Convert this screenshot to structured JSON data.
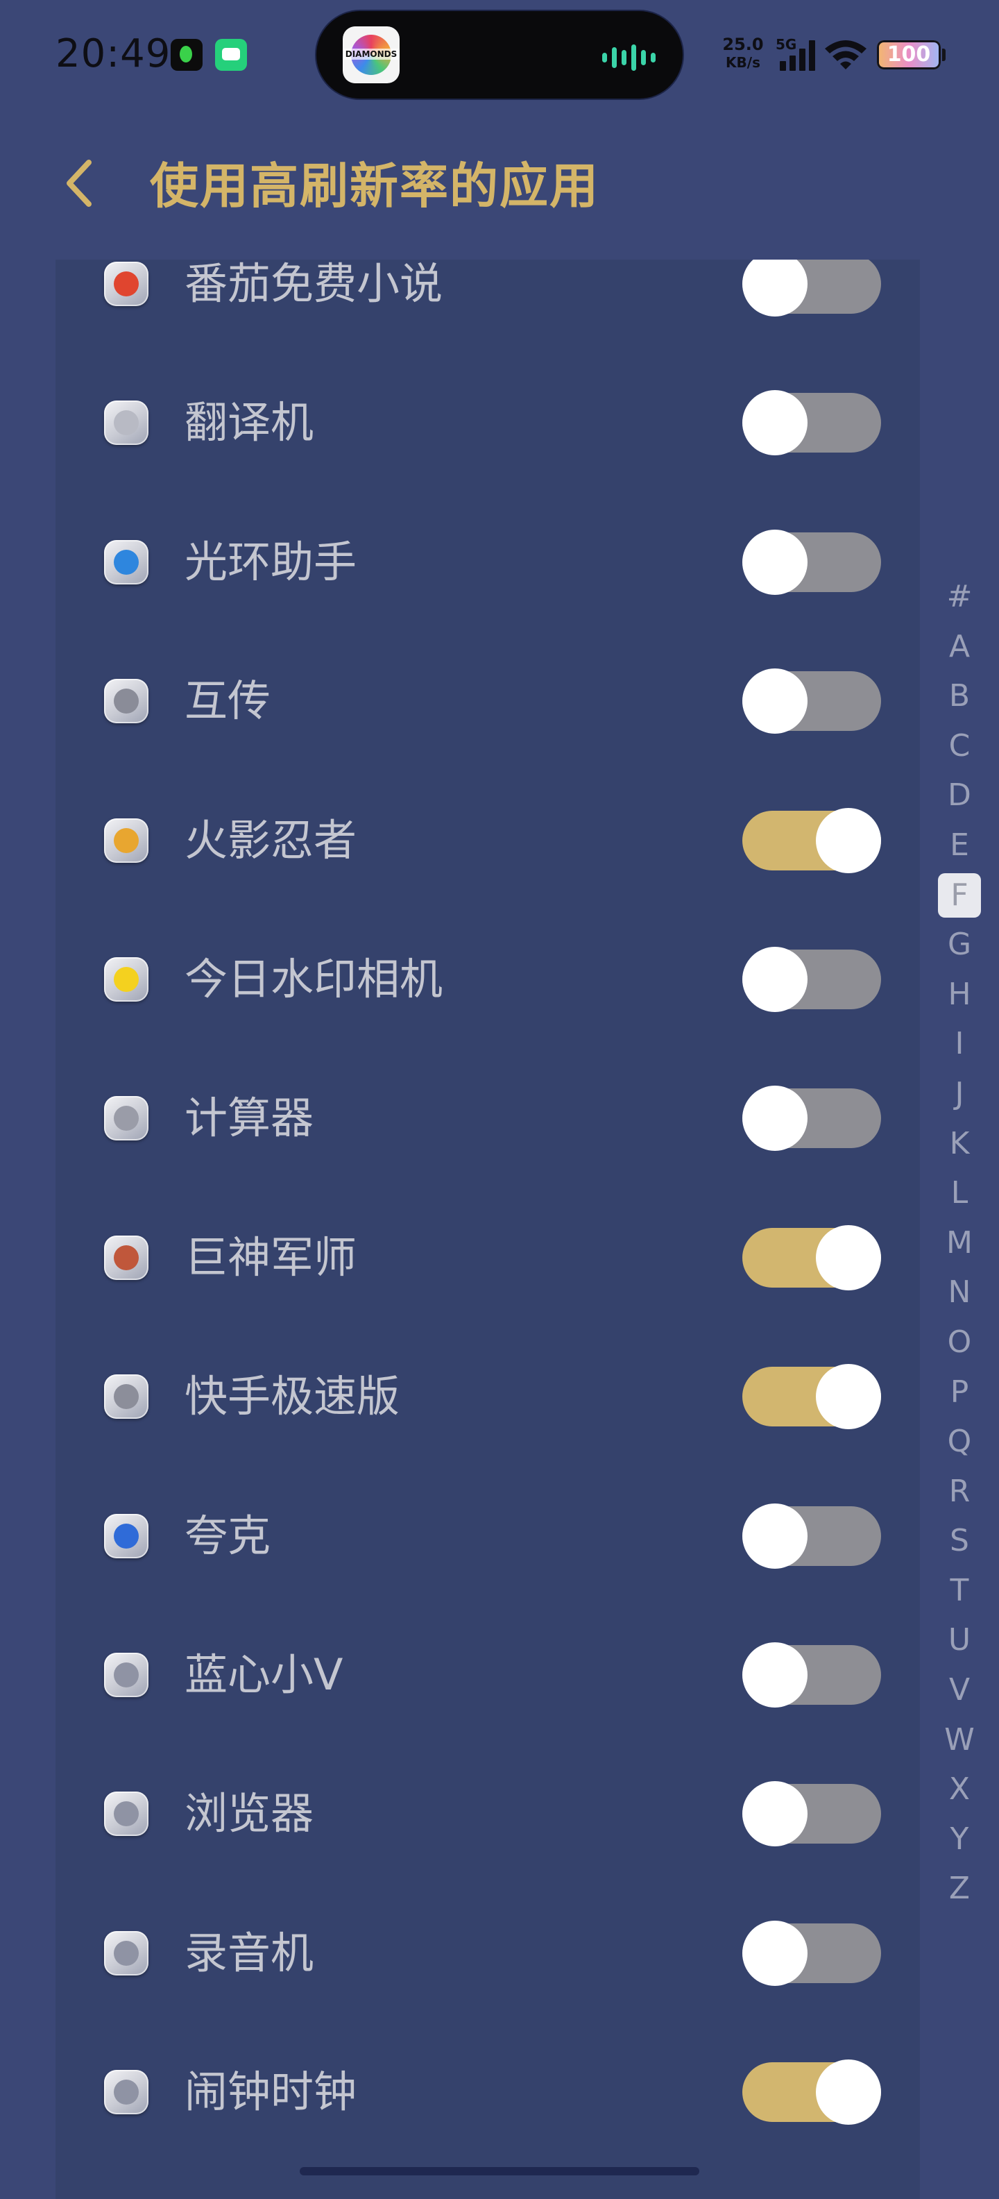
{
  "status_bar": {
    "time": "20:49",
    "net_speed_value": "25.0",
    "net_speed_unit": "KB/s",
    "network": "5G",
    "battery": "100",
    "island_app_label": "DIAMONDS"
  },
  "header": {
    "title": "使用高刷新率的应用"
  },
  "apps": [
    {
      "name": "番茄免费小说",
      "enabled": false,
      "icon": "fanqie-novel-icon",
      "accent": "#e0452f"
    },
    {
      "name": "翻译机",
      "enabled": false,
      "icon": "translator-icon",
      "accent": "#b8bac4"
    },
    {
      "name": "光环助手",
      "enabled": false,
      "icon": "guanghuan-helper-icon",
      "accent": "#2e86de"
    },
    {
      "name": "互传",
      "enabled": false,
      "icon": "hu-chuan-icon",
      "accent": "#8a8c98"
    },
    {
      "name": "火影忍者",
      "enabled": true,
      "icon": "naruto-icon",
      "accent": "#e8a630"
    },
    {
      "name": "今日水印相机",
      "enabled": false,
      "icon": "watermark-camera-icon",
      "accent": "#f4d11f"
    },
    {
      "name": "计算器",
      "enabled": false,
      "icon": "calculator-icon",
      "accent": "#9a9ca8"
    },
    {
      "name": "巨神军师",
      "enabled": true,
      "icon": "jushen-junshi-icon",
      "accent": "#c0573b"
    },
    {
      "name": "快手极速版",
      "enabled": true,
      "icon": "kuaishou-lite-icon",
      "accent": "#8c8e9a"
    },
    {
      "name": "夸克",
      "enabled": false,
      "icon": "quark-icon",
      "accent": "#2f6bd8"
    },
    {
      "name": "蓝心小V",
      "enabled": false,
      "icon": "lanxin-xiaov-icon",
      "accent": "#8f93a4"
    },
    {
      "name": "浏览器",
      "enabled": false,
      "icon": "browser-icon",
      "accent": "#8f93a4"
    },
    {
      "name": "录音机",
      "enabled": false,
      "icon": "recorder-icon",
      "accent": "#8f93a4"
    },
    {
      "name": "闹钟时钟",
      "enabled": true,
      "icon": "alarm-clock-icon",
      "accent": "#8f93a4"
    }
  ],
  "alpha_index": {
    "letters": [
      "#",
      "A",
      "B",
      "C",
      "D",
      "E",
      "F",
      "G",
      "H",
      "I",
      "J",
      "K",
      "L",
      "M",
      "N",
      "O",
      "P",
      "Q",
      "R",
      "S",
      "T",
      "U",
      "V",
      "W",
      "X",
      "Y",
      "Z"
    ],
    "active": "F"
  },
  "colors": {
    "background": "#3b4776",
    "panel": "#35426c",
    "accent_gold": "#d4b568",
    "toggle_on": "#d2b66f",
    "toggle_off": "#8e8e94"
  }
}
